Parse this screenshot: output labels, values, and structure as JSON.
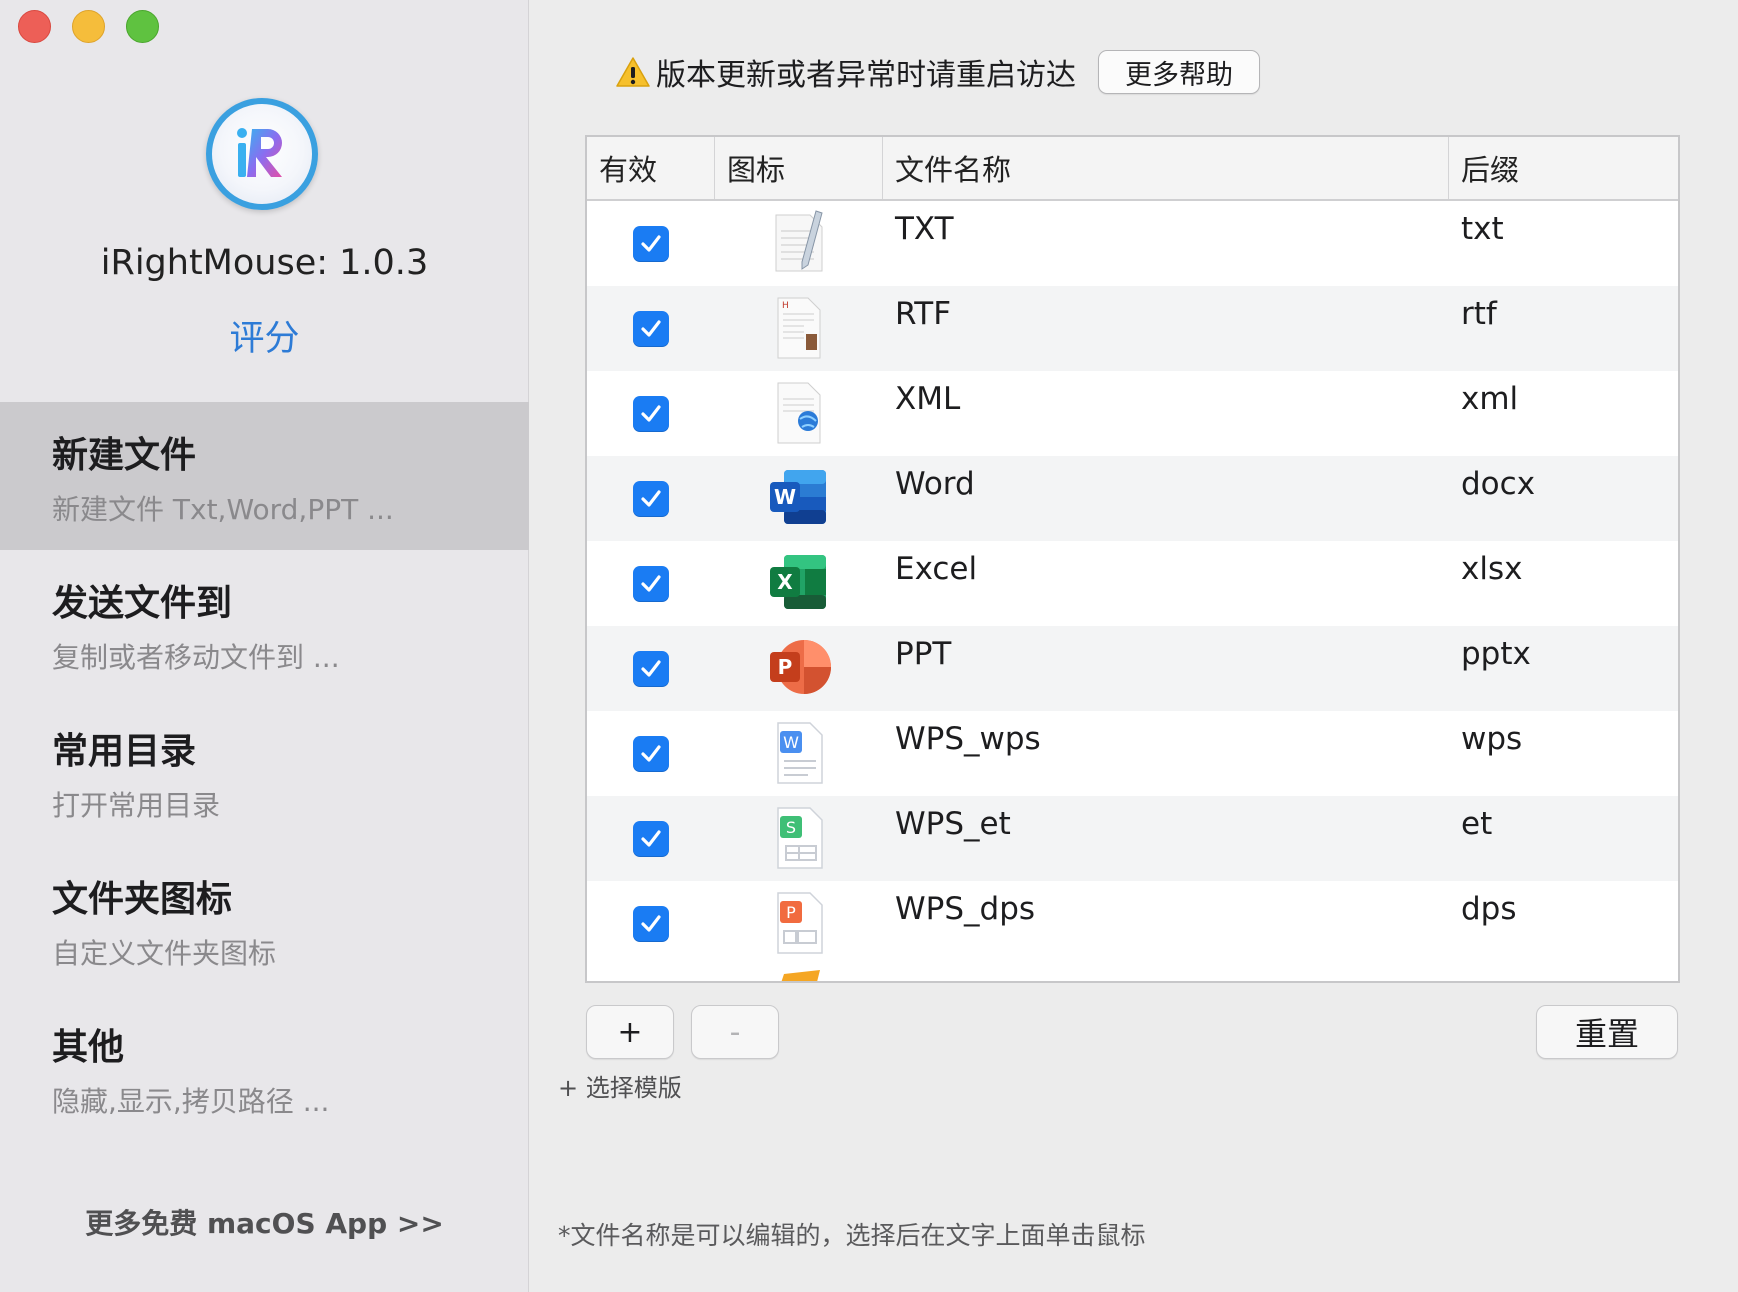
{
  "window": {
    "controls": [
      "close",
      "minimize",
      "maximize"
    ]
  },
  "sidebar": {
    "logo_icon": "irightmouse-logo",
    "app_version": "iRightMouse: 1.0.3",
    "rate_label": "评分",
    "items": [
      {
        "title": "新建文件",
        "subtitle": "新建文件 Txt,Word,PPT ...",
        "active": true
      },
      {
        "title": "发送文件到",
        "subtitle": "复制或者移动文件到 ..."
      },
      {
        "title": "常用目录",
        "subtitle": "打开常用目录"
      },
      {
        "title": "文件夹图标",
        "subtitle": "自定义文件夹图标"
      },
      {
        "title": "其他",
        "subtitle": "隐藏,显示,拷贝路径 ..."
      }
    ],
    "more_apps": "更多免费 macOS App >>"
  },
  "main": {
    "notice_icon": "warning-icon",
    "notice_text": "版本更新或者异常时请重启访达",
    "help_button": "更多帮助",
    "table": {
      "headers": [
        "有效",
        "图标",
        "文件名称",
        "后缀"
      ],
      "rows": [
        {
          "enabled": true,
          "icon": "txt-file-icon",
          "name": "TXT",
          "ext": "txt"
        },
        {
          "enabled": true,
          "icon": "rtf-file-icon",
          "name": "RTF",
          "ext": "rtf"
        },
        {
          "enabled": true,
          "icon": "xml-file-icon",
          "name": "XML",
          "ext": "xml"
        },
        {
          "enabled": true,
          "icon": "word-icon",
          "name": "Word",
          "ext": "docx"
        },
        {
          "enabled": true,
          "icon": "excel-icon",
          "name": "Excel",
          "ext": "xlsx"
        },
        {
          "enabled": true,
          "icon": "powerpoint-icon",
          "name": "PPT",
          "ext": "pptx"
        },
        {
          "enabled": true,
          "icon": "wps-writer-icon",
          "name": "WPS_wps",
          "ext": "wps"
        },
        {
          "enabled": true,
          "icon": "wps-spreadsheet-icon",
          "name": "WPS_et",
          "ext": "et"
        },
        {
          "enabled": true,
          "icon": "wps-presentation-icon",
          "name": "WPS_dps",
          "ext": "dps"
        }
      ]
    },
    "add_button": "+",
    "remove_button": "-",
    "template_link": "+ 选择模版",
    "reset_button": "重置",
    "footnote": "*文件名称是可以编辑的，选择后在文字上面单击鼠标"
  },
  "colors": {
    "accent": "#1a7cf3",
    "link": "#2d7bd6",
    "close": "#ed5f57",
    "minimize": "#f5bd3b",
    "maximize": "#5fc240"
  }
}
